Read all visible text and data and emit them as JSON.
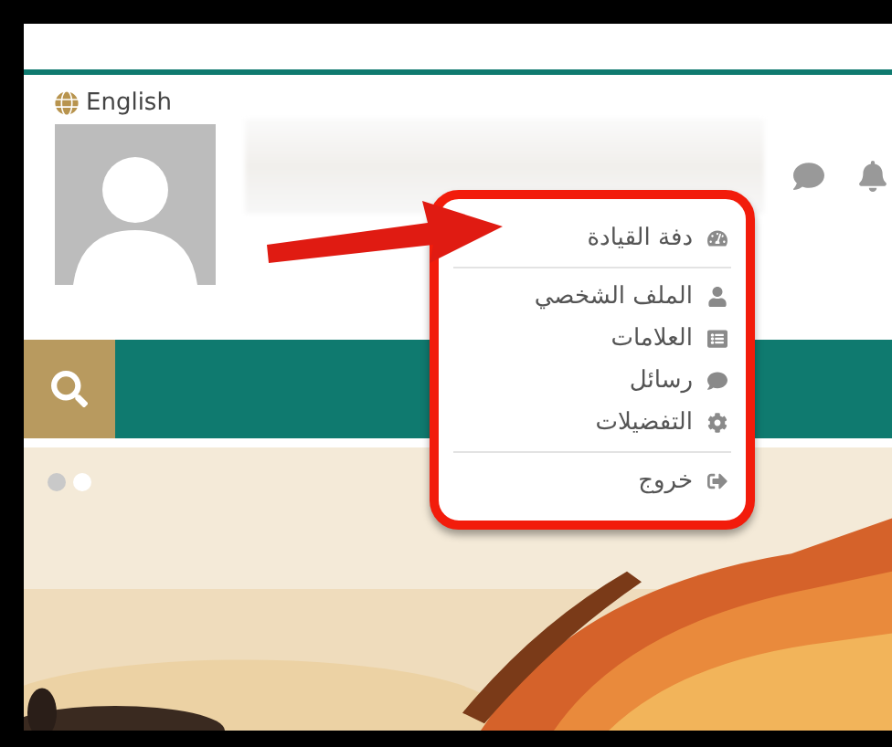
{
  "language_link": {
    "label": "English"
  },
  "menu": {
    "groups": [
      {
        "items": [
          {
            "label": "دفة القيادة"
          }
        ]
      },
      {
        "items": [
          {
            "label": "الملف الشخصي"
          },
          {
            "label": "العلامات"
          },
          {
            "label": "رسائل"
          },
          {
            "label": "التفضيلات"
          }
        ]
      },
      {
        "items": [
          {
            "label": "خروج"
          }
        ]
      }
    ]
  },
  "slider": {
    "dots": [
      {
        "selected": false
      },
      {
        "selected": true
      }
    ]
  }
}
